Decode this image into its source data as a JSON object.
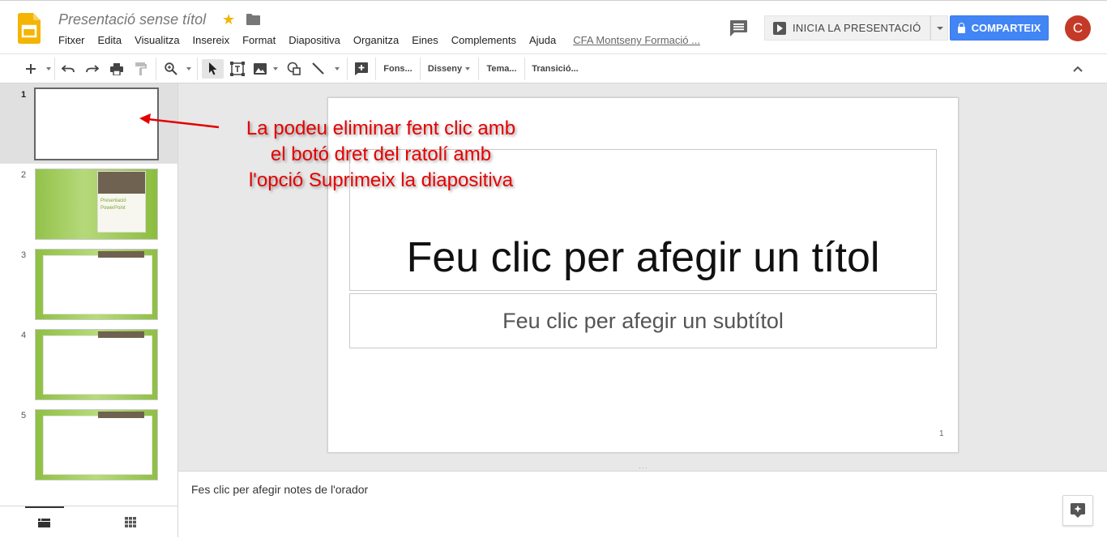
{
  "header": {
    "doc_title": "Presentació sense títol",
    "menus": [
      "Fitxer",
      "Edita",
      "Visualitza",
      "Insereix",
      "Format",
      "Diapositiva",
      "Organitza",
      "Eines",
      "Complements",
      "Ajuda"
    ],
    "org_link": "CFA Montseny Formació ...",
    "present_label": "INICIA LA PRESENTACIÓ",
    "share_label": "COMPARTEIX",
    "avatar_initial": "C",
    "colors": {
      "share": "#4285f4",
      "avatar": "#c53929",
      "star": "#f4b400",
      "logo": "#f4b400"
    },
    "icons": [
      "slides-logo-icon",
      "star-icon",
      "folder-icon",
      "comments-icon",
      "play-icon",
      "lock-icon"
    ]
  },
  "toolbar": {
    "background_label": "Fons...",
    "layout_label": "Disseny",
    "theme_label": "Tema...",
    "transition_label": "Transició...",
    "icons": [
      "new-slide-icon",
      "undo-icon",
      "redo-icon",
      "print-icon",
      "paint-format-icon",
      "zoom-icon",
      "select-icon",
      "textbox-icon",
      "image-icon",
      "shape-icon",
      "line-icon",
      "comment-add-icon",
      "collapse-icon"
    ]
  },
  "filmstrip": {
    "slides": [
      {
        "number": "1",
        "selected": true
      },
      {
        "number": "2",
        "thumb_text": "Presentació PowerPoint"
      },
      {
        "number": "3"
      },
      {
        "number": "4"
      },
      {
        "number": "5"
      }
    ],
    "theme_colors": {
      "green": "#93c24a",
      "brown": "#6f6250"
    }
  },
  "slide": {
    "title_placeholder": "Feu clic per afegir un títol",
    "subtitle_placeholder": "Feu clic per afegir un subtítol",
    "slide_number": "1"
  },
  "notes": {
    "placeholder": "Fes clic per afegir notes de l'orador"
  },
  "annotation": {
    "line1": "La podeu eliminar fent clic amb",
    "line2": "el botó dret del ratolí amb",
    "line3": "l'opció Suprimeix la diapositiva",
    "color": "#e50000"
  }
}
